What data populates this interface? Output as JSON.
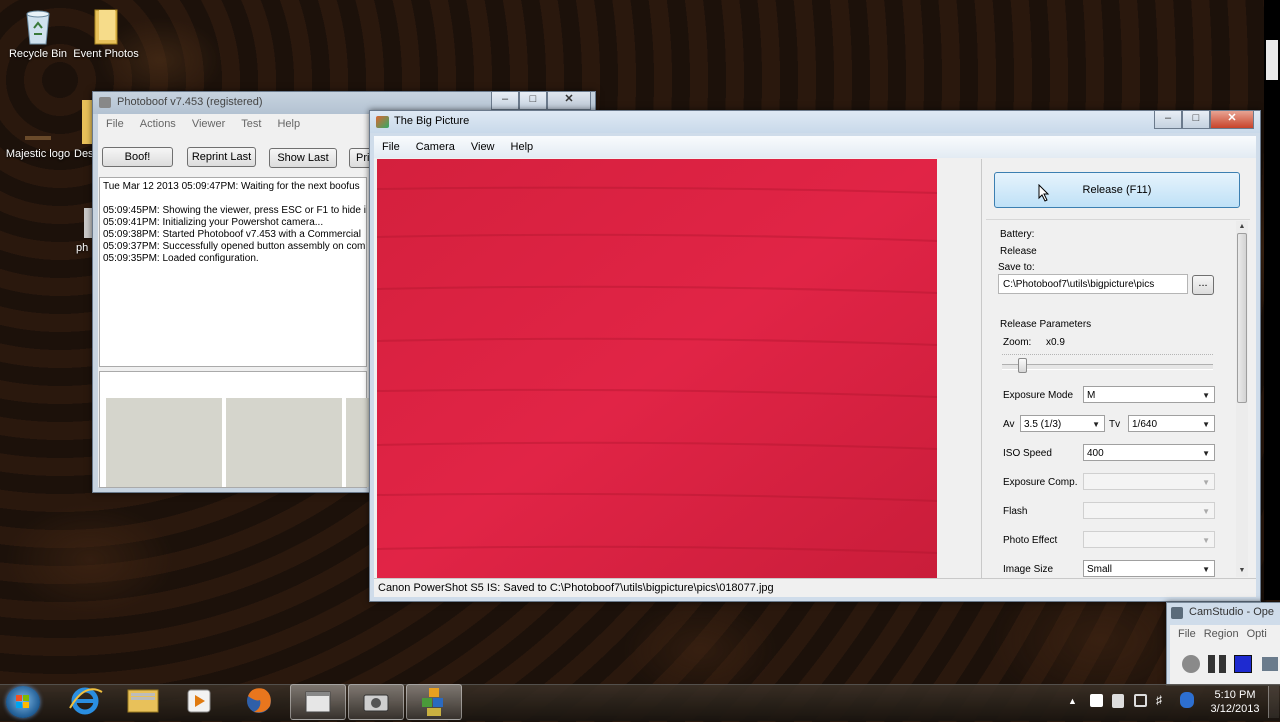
{
  "desktop": {
    "icons": [
      {
        "label": "Recycle Bin",
        "icon": "recycle-bin-icon"
      },
      {
        "label": "Event Photos",
        "icon": "folder-icon"
      },
      {
        "label": "Majestic logo",
        "icon": "image-icon"
      },
      {
        "label": "Des",
        "icon": "file-icon"
      },
      {
        "label": "ph",
        "icon": "file-icon"
      }
    ]
  },
  "photoboof": {
    "title": "Photoboof v7.453 (registered)",
    "menu": [
      "File",
      "Actions",
      "Viewer",
      "Test",
      "Help"
    ],
    "buttons": [
      "Boof!",
      "Reprint Last",
      "Show Last",
      "Pri"
    ],
    "log": [
      "Tue Mar 12 2013 05:09:47PM: Waiting for the next boofus",
      "",
      "05:09:45PM: Showing the viewer, press ESC or F1 to hide it",
      "05:09:41PM: Initializing your Powershot camera...",
      "05:09:38PM: Started Photoboof v7.453 with a Commercial",
      "05:09:37PM: Successfully opened button assembly on com",
      "05:09:35PM: Loaded configuration."
    ]
  },
  "bigpicture": {
    "title": "The Big Picture",
    "menu": [
      "File",
      "Camera",
      "View",
      "Help"
    ],
    "release_button": "Release (F11)",
    "battery_label": "Battery:",
    "release_group": "Release",
    "save_to_label": "Save to:",
    "save_to_value": "C:\\Photoboof7\\utils\\bigpicture\\pics",
    "browse_button": "...",
    "params_group": "Release Parameters",
    "zoom_label": "Zoom:",
    "zoom_value": "x0.9",
    "zoom_level": 0.08,
    "exposure_mode_label": "Exposure Mode",
    "exposure_mode_value": "M",
    "av_label": "Av",
    "av_value": "3.5 (1/3)",
    "tv_label": "Tv",
    "tv_value": "1/640",
    "iso_label": "ISO Speed",
    "iso_value": "400",
    "exp_comp_label": "Exposure Comp.",
    "flash_label": "Flash",
    "photo_effect_label": "Photo Effect",
    "image_size_label": "Image Size",
    "image_size_value": "Small",
    "status": "Canon PowerShot S5 IS: Saved to C:\\Photoboof7\\utils\\bigpicture\\pics\\018077.jpg",
    "preview_color": "#d8203f"
  },
  "camstudio": {
    "title": "CamStudio - Ope",
    "menu": [
      "File",
      "Region",
      "Opti"
    ]
  },
  "taskbar": {
    "time": "5:10 PM",
    "date": "3/12/2013"
  }
}
